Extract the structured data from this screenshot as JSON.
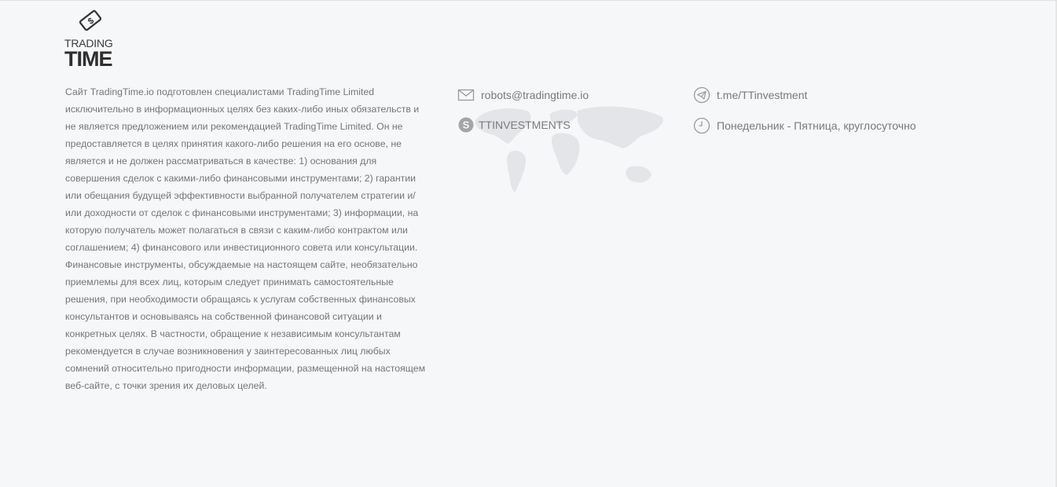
{
  "logo": {
    "icon": "dollar-bill-icon",
    "line1": "TRADING",
    "line2": "TIME"
  },
  "disclaimer": {
    "paragraph1": "Сайт TradingTime.io подготовлен специалистами TradingTime Limited исключительно в информационных целях без каких-либо иных обязательств и не является предложением или рекомендацией TradingTime Limited. Он не предоставляется в целях принятия какого-либо решения на его основе, не является и не должен рассматриваться в качестве: 1) основания для совершения сделок с какими-либо финансовыми инструментами; 2) гарантии или обещания будущей эффективности выбранной получателем стратегии и/или доходности от сделок с финансовыми инструментами; 3) информации, на которую получатель может полагаться в связи с каким-либо контрактом или соглашением; 4) финансового или инвестиционного совета или консультации.",
    "paragraph2": "Финансовые инструменты, обсуждаемые на настоящем сайте, необязательно приемлемы для всех лиц, которым следует принимать самостоятельные решения, при необходимости обращаясь к услугам собственных финансовых консультантов и основываясь на собственной финансовой ситуации и конкретных целях. В частности, обращение к независимым консультантам рекомендуется в случае возникновения у заинтересованных лиц любых сомнений относительно пригодности информации, размещенной на настоящем веб-сайте, с точки зрения их деловых целей."
  },
  "contacts": {
    "email": {
      "icon": "envelope-icon",
      "text": "robots@tradingtime.io"
    },
    "skype": {
      "icon": "skype-icon",
      "text": "TTINVESTMENTS"
    },
    "telegram": {
      "icon": "telegram-icon",
      "text": "t.me/TTinvestment"
    },
    "hours": {
      "icon": "clock-icon",
      "text": "Понедельник - Пятница, круглосуточно"
    }
  },
  "colors": {
    "background": "#f6f7f9",
    "text": "#767676",
    "logo": "#2f2f2f",
    "map": "#e4e6e9"
  }
}
